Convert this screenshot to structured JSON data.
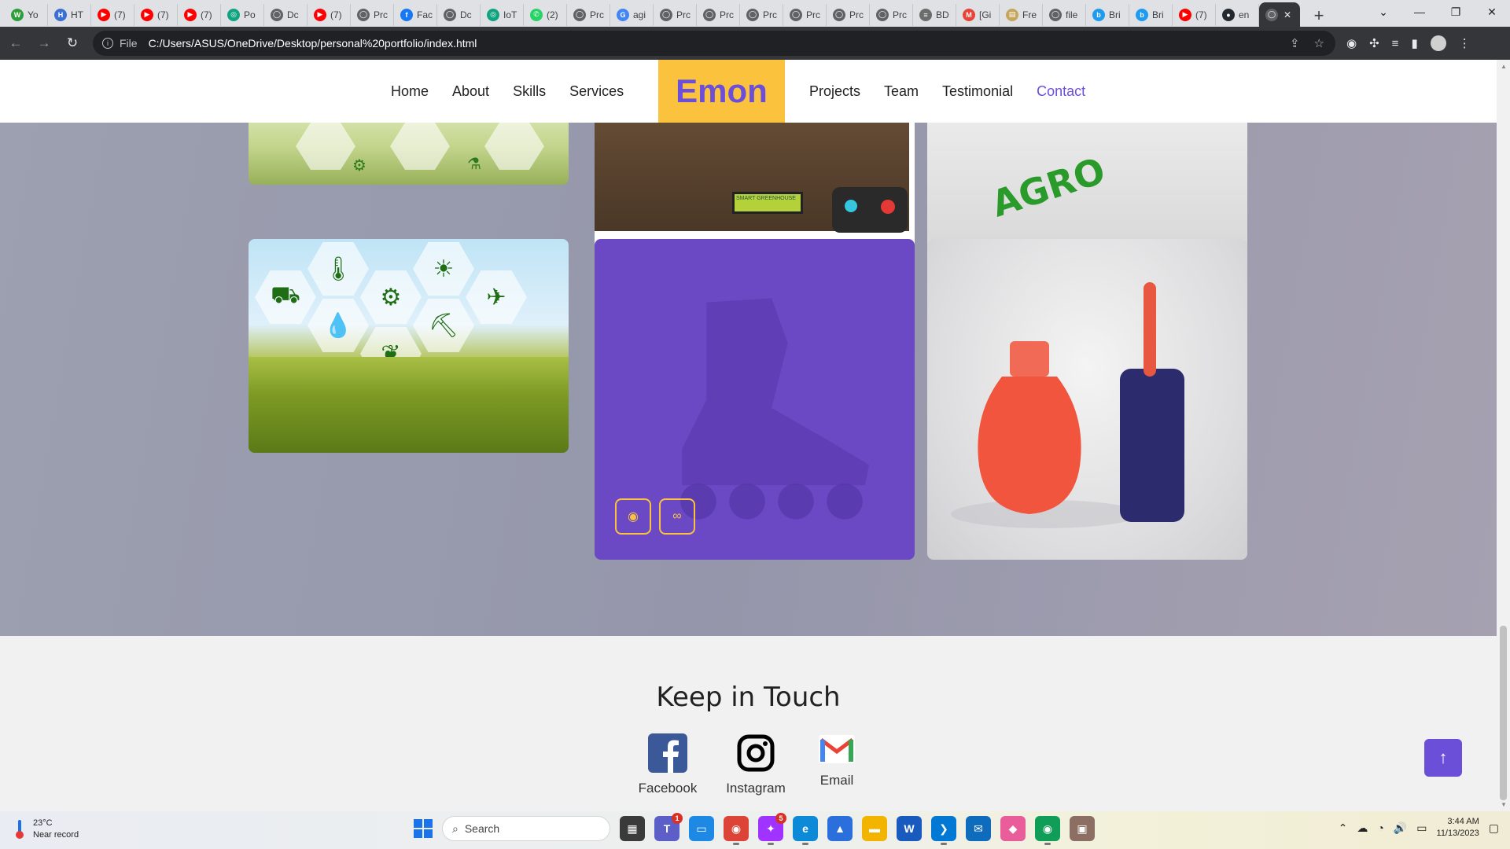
{
  "browser": {
    "tabs": [
      {
        "label": "Yo",
        "color": "#2e9e3a",
        "glyph": "W"
      },
      {
        "label": "HT",
        "color": "#3b6fd1",
        "glyph": "H"
      },
      {
        "label": "(7)",
        "color": "#ff0000",
        "glyph": "▶"
      },
      {
        "label": "(7)",
        "color": "#ff0000",
        "glyph": "▶"
      },
      {
        "label": "(7)",
        "color": "#ff0000",
        "glyph": "▶"
      },
      {
        "label": "Po",
        "color": "#10a37f",
        "glyph": "◎"
      },
      {
        "label": "Dc",
        "color": "#5f6368",
        "glyph": "◯"
      },
      {
        "label": "(7)",
        "color": "#ff0000",
        "glyph": "▶"
      },
      {
        "label": "Prc",
        "color": "#5f6368",
        "glyph": "◯"
      },
      {
        "label": "Fac",
        "color": "#1877f2",
        "glyph": "f"
      },
      {
        "label": "Dc",
        "color": "#5f6368",
        "glyph": "◯"
      },
      {
        "label": "IoT",
        "color": "#10a37f",
        "glyph": "◎"
      },
      {
        "label": "(2)",
        "color": "#25d366",
        "glyph": "✆"
      },
      {
        "label": "Prc",
        "color": "#5f6368",
        "glyph": "◯"
      },
      {
        "label": "agi",
        "color": "#4285f4",
        "glyph": "G"
      },
      {
        "label": "Prc",
        "color": "#5f6368",
        "glyph": "◯"
      },
      {
        "label": "Prc",
        "color": "#5f6368",
        "glyph": "◯"
      },
      {
        "label": "Prc",
        "color": "#5f6368",
        "glyph": "◯"
      },
      {
        "label": "Prc",
        "color": "#5f6368",
        "glyph": "◯"
      },
      {
        "label": "Prc",
        "color": "#5f6368",
        "glyph": "◯"
      },
      {
        "label": "Prc",
        "color": "#5f6368",
        "glyph": "◯"
      },
      {
        "label": "BD",
        "color": "#6c6c6c",
        "glyph": "≡"
      },
      {
        "label": "[Gi",
        "color": "#ea4335",
        "glyph": "M"
      },
      {
        "label": "Fre",
        "color": "#c5a65a",
        "glyph": "▤"
      },
      {
        "label": "file",
        "color": "#5f6368",
        "glyph": "◯"
      },
      {
        "label": "Bri",
        "color": "#1d9bf0",
        "glyph": "b"
      },
      {
        "label": "Bri",
        "color": "#1d9bf0",
        "glyph": "b"
      },
      {
        "label": "(7)",
        "color": "#ff0000",
        "glyph": "▶"
      },
      {
        "label": "en",
        "color": "#24292f",
        "glyph": "●"
      }
    ],
    "window_controls": {
      "minimize": "—",
      "maximize": "❐",
      "close": "✕"
    },
    "address": {
      "scheme": "File",
      "url": "C:/Users/ASUS/OneDrive/Desktop/personal%20portfolio/index.html"
    }
  },
  "site": {
    "nav_left": [
      "Home",
      "About",
      "Skills",
      "Services"
    ],
    "brand": "Emon",
    "nav_right": [
      "Projects",
      "Team",
      "Testimonial",
      "Contact"
    ],
    "active_nav": "Contact",
    "colors": {
      "accent": "#6c4fd9",
      "brand_bg": "#fbc33d"
    },
    "lcd_text": "SMART GREENHOUSE",
    "agro_text": "AGRO",
    "project_buttons": {
      "view_icon": "eye-icon",
      "link_icon": "link-icon"
    },
    "footer": {
      "title": "Keep in Touch",
      "socials": [
        {
          "label": "Facebook",
          "icon": "facebook-icon"
        },
        {
          "label": "Instagram",
          "icon": "instagram-icon"
        },
        {
          "label": "Email",
          "icon": "gmail-icon"
        }
      ]
    },
    "back_to_top": "↑"
  },
  "taskbar": {
    "weather": {
      "temp": "23°C",
      "desc": "Near record"
    },
    "search_placeholder": "Search",
    "apps": [
      {
        "name": "file-manager",
        "color": "#3a3a3a",
        "glyph": "▦"
      },
      {
        "name": "teams",
        "color": "#5b5fc7",
        "glyph": "T",
        "badge": "1"
      },
      {
        "name": "device",
        "color": "#1e88e5",
        "glyph": "▭"
      },
      {
        "name": "chrome",
        "color": "#db4437",
        "glyph": "◉"
      },
      {
        "name": "messenger",
        "color": "#a033ff",
        "glyph": "✦",
        "badge": "5"
      },
      {
        "name": "edge",
        "color": "#0c8ad8",
        "glyph": "e"
      },
      {
        "name": "photos",
        "color": "#2a6fdb",
        "glyph": "▲"
      },
      {
        "name": "explorer",
        "color": "#f3b400",
        "glyph": "▬"
      },
      {
        "name": "word",
        "color": "#185abd",
        "glyph": "W"
      },
      {
        "name": "vscode",
        "color": "#0078d4",
        "glyph": "❯"
      },
      {
        "name": "mail",
        "color": "#0f6cbd",
        "glyph": "✉"
      },
      {
        "name": "paint",
        "color": "#e85d9a",
        "glyph": "◆"
      },
      {
        "name": "chrome-profile",
        "color": "#0f9d58",
        "glyph": "◉"
      },
      {
        "name": "archive",
        "color": "#8d6e63",
        "glyph": "▣"
      }
    ],
    "clock": {
      "time": "3:44 AM",
      "date": "11/13/2023"
    }
  }
}
